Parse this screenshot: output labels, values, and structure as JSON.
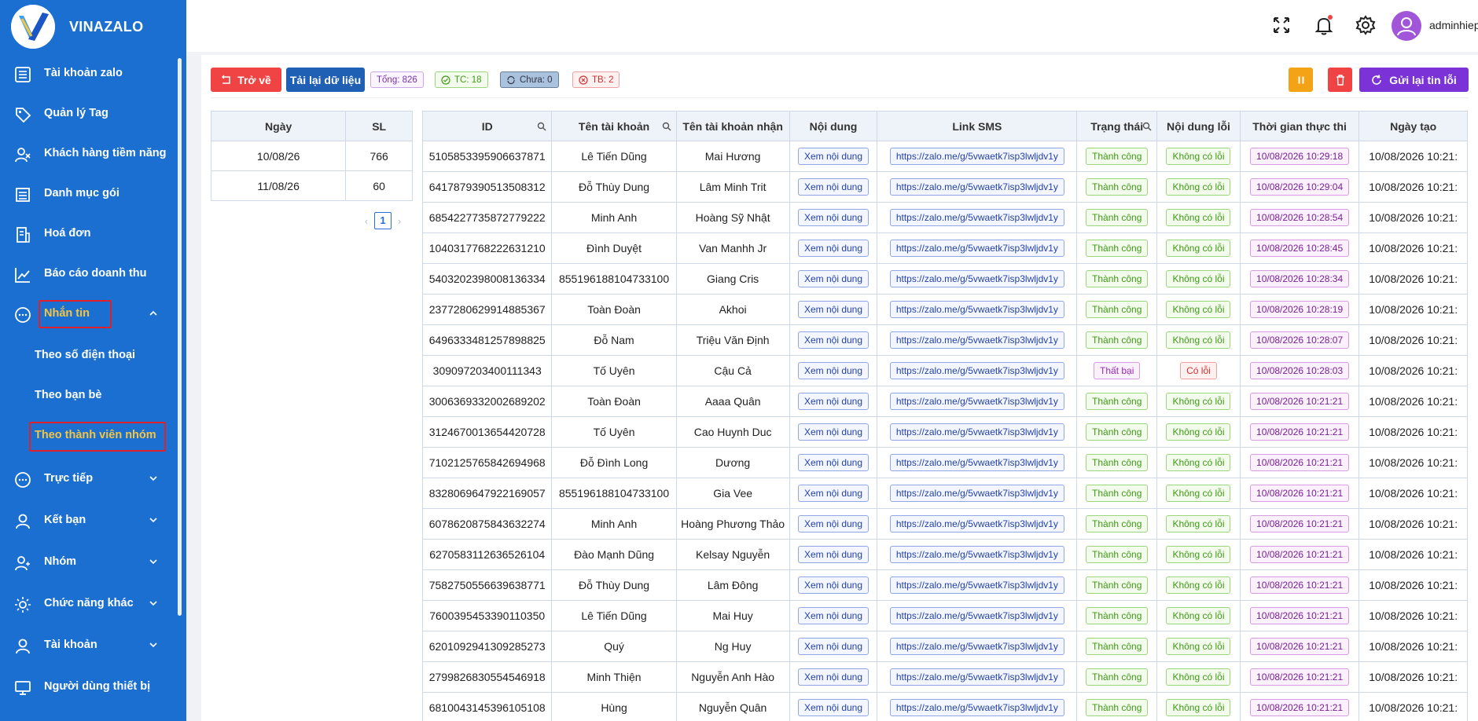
{
  "brand": {
    "name": "VINAZALO"
  },
  "sidebar": {
    "items": [
      {
        "label": "Tài khoản zalo",
        "icon": "list-icon"
      },
      {
        "label": "Quản lý Tag",
        "icon": "tag-icon"
      },
      {
        "label": "Khách hàng tiềm năng",
        "icon": "users-icon"
      },
      {
        "label": "Danh mục gói",
        "icon": "package-icon"
      },
      {
        "label": "Hoá đơn",
        "icon": "invoice-icon"
      },
      {
        "label": "Báo cáo doanh thu",
        "icon": "chart-icon"
      },
      {
        "label": "Nhắn tin",
        "icon": "chat-icon"
      },
      {
        "label": "Trực tiếp",
        "icon": "chat-icon"
      },
      {
        "label": "Kết bạn",
        "icon": "user-icon"
      },
      {
        "label": "Nhóm",
        "icon": "group-icon"
      },
      {
        "label": "Chức năng khác",
        "icon": "sun-icon"
      },
      {
        "label": "Tài khoản",
        "icon": "user-icon"
      },
      {
        "label": "Người dùng thiết bị",
        "icon": "monitor-icon"
      }
    ],
    "submenu": [
      {
        "label": "Theo số điện thoại"
      },
      {
        "label": "Theo bạn bè"
      },
      {
        "label": "Theo thành viên nhóm"
      }
    ]
  },
  "topbar": {
    "username": "adminhiep"
  },
  "toolbar": {
    "back_label": "Trở về",
    "reload_label": "Tải lại dữ liệu",
    "total_tag": "Tổng: 826",
    "success_tag": "TC: 18",
    "pending_tag": "Chưa: 0",
    "fail_tag": "TB: 2",
    "resend_label": "Gửi lại tin lỗi",
    "colors": {
      "red": "#f04343",
      "blue": "#1f5fb4",
      "orange": "#f5a316",
      "purple": "#7b33d8"
    }
  },
  "summary": {
    "headers": [
      "Ngày",
      "SL"
    ],
    "rows": [
      [
        "10/08/26",
        "766"
      ],
      [
        "11/08/26",
        "60"
      ]
    ],
    "page": "1"
  },
  "table": {
    "headers": [
      "ID",
      "Tên tài khoản",
      "Tên tài khoản nhận",
      "Nội dung",
      "Link SMS",
      "Trạng thái",
      "Nội dung lỗi",
      "Thời gian thực thi",
      "Ngày tạo"
    ],
    "rows": [
      [
        "5105853395906637871",
        "Lê Tiến Dũng",
        "Mai Hương",
        "Xem nội dung",
        "https://zalo.me/g/5vwaetk7isp3lwljdv1y",
        "Thành công",
        "Không có lỗi",
        "10/08/2026 10:29:18",
        "10/08/2026 10:21:"
      ],
      [
        "6417879390513508312",
        "Đỗ Thùy Dung",
        "Lâm Minh Trit",
        "Xem nội dung",
        "https://zalo.me/g/5vwaetk7isp3lwljdv1y",
        "Thành công",
        "Không có lỗi",
        "10/08/2026 10:29:04",
        "10/08/2026 10:21:"
      ],
      [
        "6854227735872779222",
        "Minh Anh",
        "Hoàng Sỹ Nhật",
        "Xem nội dung",
        "https://zalo.me/g/5vwaetk7isp3lwljdv1y",
        "Thành công",
        "Không có lỗi",
        "10/08/2026 10:28:54",
        "10/08/2026 10:21:"
      ],
      [
        "1040317768222631210",
        "Đình Duyệt",
        "Van Manhh Jr",
        "Xem nội dung",
        "https://zalo.me/g/5vwaetk7isp3lwljdv1y",
        "Thành công",
        "Không có lỗi",
        "10/08/2026 10:28:45",
        "10/08/2026 10:21:"
      ],
      [
        "5403202398008136334",
        "855196188104733100",
        "Giang Cris",
        "Xem nội dung",
        "https://zalo.me/g/5vwaetk7isp3lwljdv1y",
        "Thành công",
        "Không có lỗi",
        "10/08/2026 10:28:34",
        "10/08/2026 10:21:"
      ],
      [
        "2377280629914885367",
        "Toàn Đoàn",
        "Akhoi",
        "Xem nội dung",
        "https://zalo.me/g/5vwaetk7isp3lwljdv1y",
        "Thành công",
        "Không có lỗi",
        "10/08/2026 10:28:19",
        "10/08/2026 10:21:"
      ],
      [
        "6496333481257898825",
        "Đỗ Nam",
        "Triệu Văn Định",
        "Xem nội dung",
        "https://zalo.me/g/5vwaetk7isp3lwljdv1y",
        "Thành công",
        "Không có lỗi",
        "10/08/2026 10:28:07",
        "10/08/2026 10:21:"
      ],
      [
        "309097203400111343",
        "Tố Uyên",
        "Cậu Cả",
        "Xem nội dung",
        "https://zalo.me/g/5vwaetk7isp3lwljdv1y",
        "Thất bại",
        "Có lỗi",
        "10/08/2026 10:28:03",
        "10/08/2026 10:21:"
      ],
      [
        "3006369332002689202",
        "Toàn Đoàn",
        "Aaaa Quân",
        "Xem nội dung",
        "https://zalo.me/g/5vwaetk7isp3lwljdv1y",
        "Thành công",
        "Không có lỗi",
        "10/08/2026 10:21:21",
        "10/08/2026 10:21:"
      ],
      [
        "3124670013654420728",
        "Tố Uyên",
        "Cao Huynh Duc",
        "Xem nội dung",
        "https://zalo.me/g/5vwaetk7isp3lwljdv1y",
        "Thành công",
        "Không có lỗi",
        "10/08/2026 10:21:21",
        "10/08/2026 10:21:"
      ],
      [
        "7102125765842694968",
        "Đỗ Đình Long",
        "Dương",
        "Xem nội dung",
        "https://zalo.me/g/5vwaetk7isp3lwljdv1y",
        "Thành công",
        "Không có lỗi",
        "10/08/2026 10:21:21",
        "10/08/2026 10:21:"
      ],
      [
        "8328069647922169057",
        "855196188104733100",
        "Gia Vee",
        "Xem nội dung",
        "https://zalo.me/g/5vwaetk7isp3lwljdv1y",
        "Thành công",
        "Không có lỗi",
        "10/08/2026 10:21:21",
        "10/08/2026 10:21:"
      ],
      [
        "6078620875843632274",
        "Minh Anh",
        "Hoàng Phương Thảo",
        "Xem nội dung",
        "https://zalo.me/g/5vwaetk7isp3lwljdv1y",
        "Thành công",
        "Không có lỗi",
        "10/08/2026 10:21:21",
        "10/08/2026 10:21:"
      ],
      [
        "6270583112636526104",
        "Đào Mạnh Dũng",
        "Kelsay Nguyễn",
        "Xem nội dung",
        "https://zalo.me/g/5vwaetk7isp3lwljdv1y",
        "Thành công",
        "Không có lỗi",
        "10/08/2026 10:21:21",
        "10/08/2026 10:21:"
      ],
      [
        "7582750556639638771",
        "Đỗ Thùy Dung",
        "Lâm Đông",
        "Xem nội dung",
        "https://zalo.me/g/5vwaetk7isp3lwljdv1y",
        "Thành công",
        "Không có lỗi",
        "10/08/2026 10:21:21",
        "10/08/2026 10:21:"
      ],
      [
        "7600395453390110350",
        "Lê Tiến Dũng",
        "Mai Huy",
        "Xem nội dung",
        "https://zalo.me/g/5vwaetk7isp3lwljdv1y",
        "Thành công",
        "Không có lỗi",
        "10/08/2026 10:21:21",
        "10/08/2026 10:21:"
      ],
      [
        "6201092941309285273",
        "Quý",
        "Ng Huy",
        "Xem nội dung",
        "https://zalo.me/g/5vwaetk7isp3lwljdv1y",
        "Thành công",
        "Không có lỗi",
        "10/08/2026 10:21:21",
        "10/08/2026 10:21:"
      ],
      [
        "2799826830554546918",
        "Minh Thiện",
        "Nguyễn Anh Hào",
        "Xem nội dung",
        "https://zalo.me/g/5vwaetk7isp3lwljdv1y",
        "Thành công",
        "Không có lỗi",
        "10/08/2026 10:21:21",
        "10/08/2026 10:21:"
      ],
      [
        "6810043145396105108",
        "Hùng",
        "Nguyễn Quân",
        "Xem nội dung",
        "https://zalo.me/g/5vwaetk7isp3lwljdv1y",
        "Thành công",
        "Không có lỗi",
        "10/08/2026 10:21:21",
        "10/08/2026 10:21:"
      ]
    ]
  }
}
